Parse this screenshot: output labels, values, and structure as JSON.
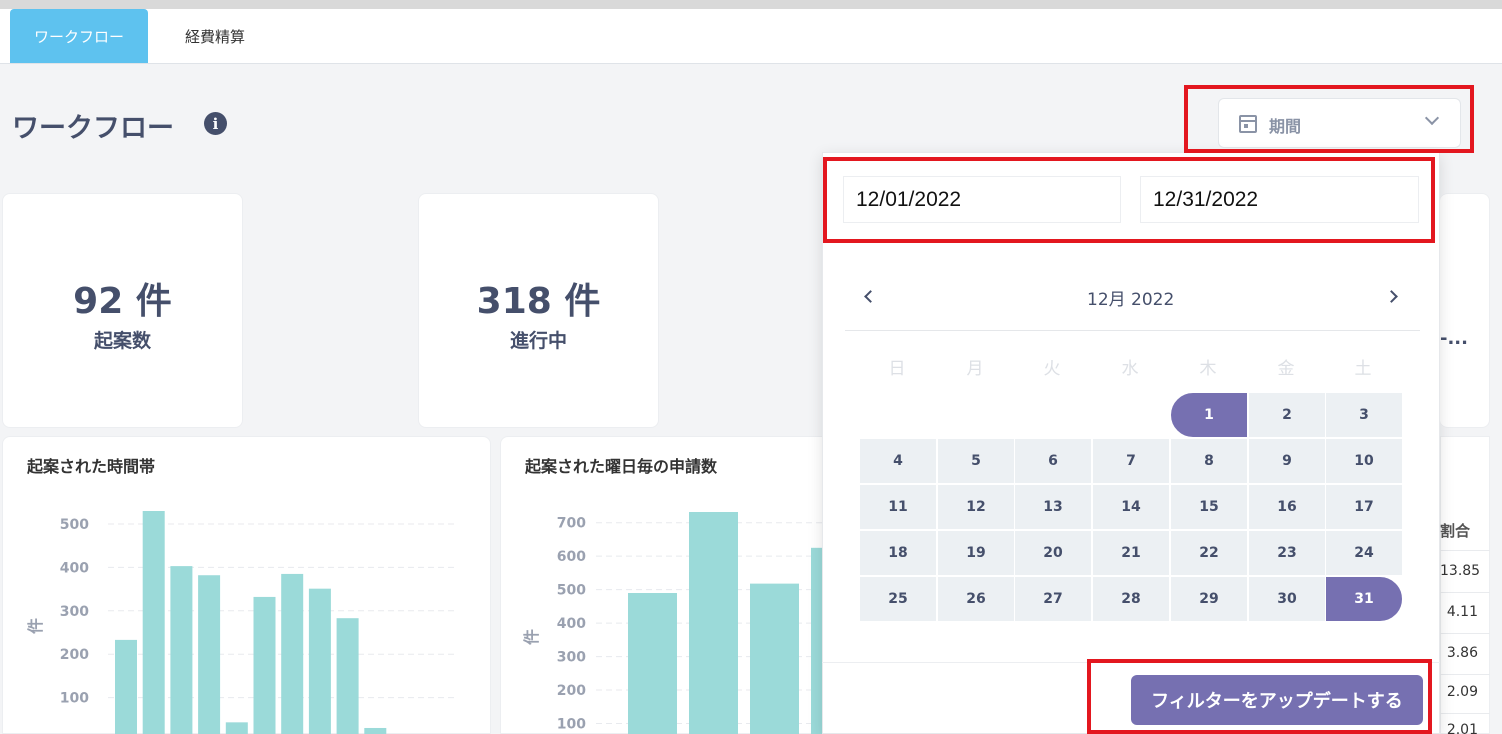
{
  "tabs": [
    {
      "label": "ワークフロー",
      "active": true
    },
    {
      "label": "経費精算",
      "active": false
    }
  ],
  "page": {
    "title": "ワークフロー",
    "info_icon": "info-icon"
  },
  "period": {
    "label": "期間",
    "icon": "calendar-icon"
  },
  "stats": [
    {
      "value": "92 件",
      "label": "起案数"
    },
    {
      "value": "318 件",
      "label": "進行中"
    }
  ],
  "stat_fragment": "-...",
  "charts": [
    {
      "title": "起案された時間帯",
      "ylabel": "件"
    },
    {
      "title": "起案された曜日毎の申請数",
      "ylabel": "件"
    }
  ],
  "right_table": {
    "header": "割合",
    "values": [
      "13.85",
      "4.11",
      "3.86",
      "2.09",
      "2.01"
    ]
  },
  "date_range": {
    "start": "12/01/2022",
    "end": "12/31/2022"
  },
  "calendar": {
    "header": "12月 2022",
    "weekdays": [
      "日",
      "月",
      "火",
      "水",
      "木",
      "金",
      "土"
    ],
    "weeks": [
      [
        "",
        "",
        "",
        "",
        "1",
        "2",
        "3"
      ],
      [
        "4",
        "5",
        "6",
        "7",
        "8",
        "9",
        "10"
      ],
      [
        "11",
        "12",
        "13",
        "14",
        "15",
        "16",
        "17"
      ],
      [
        "18",
        "19",
        "20",
        "21",
        "22",
        "23",
        "24"
      ],
      [
        "25",
        "26",
        "27",
        "28",
        "29",
        "30",
        "31"
      ]
    ],
    "selected_start": "1",
    "selected_end": "31"
  },
  "update_button": "フィルターをアップデートする",
  "colors": {
    "tab_active": "#5ec2ef",
    "accent": "#7670b1",
    "bar": "#9bdad9",
    "highlight": "#e3171f",
    "text": "#454f6b"
  },
  "chart_data": [
    {
      "type": "bar",
      "title": "起案された時間帯",
      "ylabel": "件",
      "yticks": [
        100,
        200,
        300,
        400,
        500
      ],
      "ylim": [
        0,
        560
      ],
      "values": [
        233,
        530,
        403,
        382,
        43,
        332,
        385,
        351,
        283,
        30
      ],
      "grid": true,
      "legend": "none"
    },
    {
      "type": "bar",
      "title": "起案された曜日毎の申請数",
      "ylabel": "件",
      "yticks": [
        100,
        200,
        300,
        400,
        500,
        600,
        700
      ],
      "ylim": [
        0,
        760
      ],
      "values": [
        490,
        732,
        518,
        625
      ],
      "grid": true,
      "legend": "none"
    }
  ]
}
